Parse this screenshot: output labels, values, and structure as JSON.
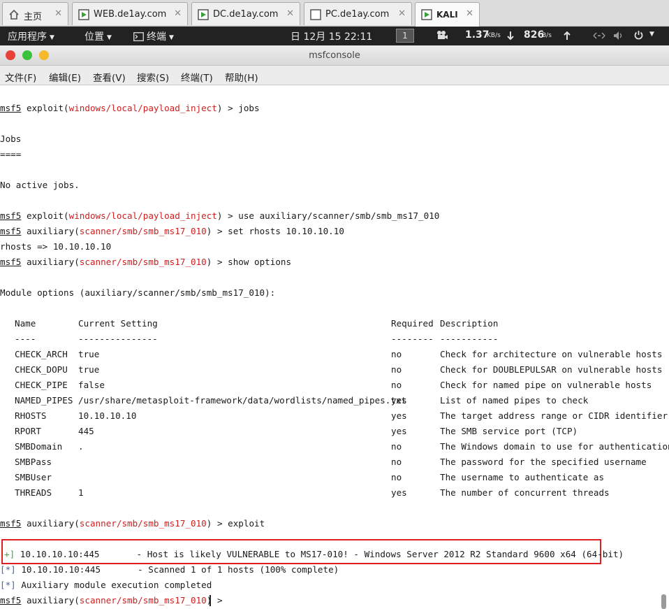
{
  "vm_tabs": [
    {
      "label": "主页",
      "icon": "home-icon"
    },
    {
      "label": "WEB.de1ay.com",
      "icon": "vm-icon"
    },
    {
      "label": "DC.de1ay.com",
      "icon": "vm-icon"
    },
    {
      "label": "PC.de1ay.com",
      "icon": "vm-icon"
    },
    {
      "label": "KALI",
      "icon": "vm-icon"
    }
  ],
  "tab_close_glyph": "✕",
  "top_panel": {
    "applications": "应用程序",
    "places": "位置",
    "terminal": "终端",
    "clock": "日 12月 15  22:11",
    "workspace": "1",
    "net_down": "1.37",
    "net_down_unit": "KB/s",
    "net_up": "826",
    "net_up_unit": "B/s"
  },
  "window": {
    "title": "msfconsole",
    "menus": [
      "文件(F)",
      "编辑(E)",
      "查看(V)",
      "搜索(S)",
      "终端(T)",
      "帮助(H)"
    ]
  },
  "terminal": {
    "prompt_msf": "msf5",
    "prompt_gt": " > ",
    "line1_kind": "exploit",
    "line1_module": "windows/local/payload_inject",
    "line1_cmd": "jobs",
    "jobs_title": "Jobs",
    "jobs_rule": "====",
    "no_jobs": "No active jobs.",
    "line2_cmd": "use auxiliary/scanner/smb/smb_ms17_010",
    "aux_kind": "auxiliary",
    "aux_module": "scanner/smb/smb_ms17_010",
    "line3_cmd": "set rhosts 10.10.10.10",
    "rhosts_echo": "rhosts => 10.10.10.10",
    "line4_cmd": "show options",
    "module_options": "Module options (auxiliary/scanner/smb/smb_ms17_010):",
    "headers": {
      "name": "Name",
      "setting": "Current Setting",
      "required": "Required",
      "description": "Description"
    },
    "rules": {
      "name": "----",
      "setting": "---------------",
      "required": "--------",
      "description": "-----------"
    },
    "options": [
      {
        "name": "CHECK_ARCH",
        "setting": "true",
        "required": "no",
        "description": "Check for architecture on vulnerable hosts"
      },
      {
        "name": "CHECK_DOPU",
        "setting": "true",
        "required": "no",
        "description": "Check for DOUBLEPULSAR on vulnerable hosts"
      },
      {
        "name": "CHECK_PIPE",
        "setting": "false",
        "required": "no",
        "description": "Check for named pipe on vulnerable hosts"
      },
      {
        "name": "NAMED_PIPES",
        "setting": "/usr/share/metasploit-framework/data/wordlists/named_pipes.txt",
        "required": "yes",
        "description": "List of named pipes to check"
      },
      {
        "name": "RHOSTS",
        "setting": "10.10.10.10",
        "required": "yes",
        "description": "The target address range or CIDR identifier"
      },
      {
        "name": "RPORT",
        "setting": "445",
        "required": "yes",
        "description": "The SMB service port (TCP)"
      },
      {
        "name": "SMBDomain",
        "setting": ".",
        "required": "no",
        "description": "The Windows domain to use for authentication"
      },
      {
        "name": "SMBPass",
        "setting": "",
        "required": "no",
        "description": "The password for the specified username"
      },
      {
        "name": "SMBUser",
        "setting": "",
        "required": "no",
        "description": "The username to authenticate as"
      },
      {
        "name": "THREADS",
        "setting": "1",
        "required": "yes",
        "description": "The number of concurrent threads"
      }
    ],
    "line5_cmd": "exploit",
    "result_plus_tag": "+]",
    "result_plus_text": " 10.10.10.10:445       - Host is likely VULNERABLE to MS17-010! - Windows Server 2012 R2 Standard 9600 x64 (64-bit)",
    "result_star_tag": "[*]",
    "result_star1_text": " 10.10.10.10:445       - Scanned 1 of 1 hosts (100% complete)",
    "result_star2_text": " Auxiliary module execution completed"
  },
  "colors": {
    "module_red": "#cd1f1f",
    "info_blue": "#3a64c4",
    "good_green": "#3ea73e",
    "highlight": "#e02020"
  }
}
